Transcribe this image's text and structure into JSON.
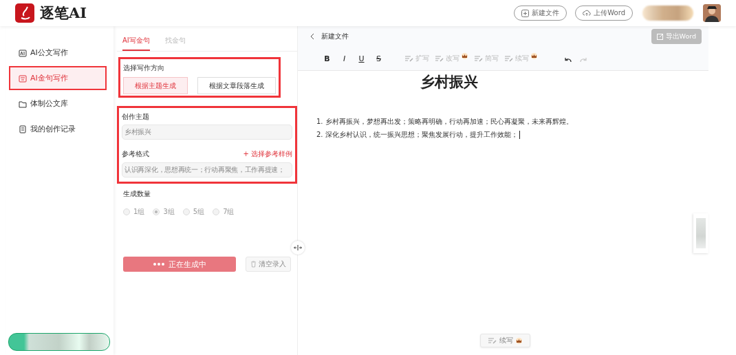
{
  "app": {
    "name": "逐笔AI"
  },
  "header": {
    "buttons": [
      {
        "label": "新建文件",
        "kind": "new"
      },
      {
        "label": "上传Word",
        "kind": "upload"
      }
    ]
  },
  "sidebar": {
    "items": [
      {
        "label": "AI公文写作",
        "kind": "ai",
        "selected": false,
        "highlighted": false
      },
      {
        "label": "AI金句写作",
        "kind": "quote",
        "selected": true,
        "highlighted": true
      },
      {
        "label": "体制公文库",
        "kind": "folder",
        "selected": false,
        "highlighted": false
      },
      {
        "label": "我的创作记录",
        "kind": "record",
        "selected": false,
        "highlighted": false
      }
    ]
  },
  "panel": {
    "tabs": [
      {
        "label": "AI写金句",
        "selected": true
      },
      {
        "label": "找金句",
        "selected": false
      }
    ],
    "direction": {
      "label": "选择写作方向",
      "highlighted": true,
      "options": [
        {
          "label": "根据主题生成",
          "selected": true
        },
        {
          "label": "根据文章段落生成",
          "selected": false
        }
      ]
    },
    "inputs": {
      "highlighted": true,
      "topic": {
        "label": "创作主题",
        "value": "乡村振兴",
        "disabled": true
      },
      "format": {
        "label": "参考格式",
        "link": "+ 选择参考样例",
        "value": "认识再深化，思想再统一；行动再聚焦，工作再提速；",
        "disabled": true
      }
    },
    "count": {
      "label": "生成数量",
      "disabled": true,
      "options": [
        {
          "label": "1组",
          "selected": false
        },
        {
          "label": "3组",
          "selected": true
        },
        {
          "label": "5组",
          "selected": false
        },
        {
          "label": "7组",
          "selected": false
        }
      ]
    },
    "generate_button": {
      "label": "正在生成中",
      "loading": true
    },
    "clear_button": {
      "label": "清空录入",
      "disabled": true
    }
  },
  "editor": {
    "back_label": "新建文件",
    "export_button": {
      "label": "导出Word",
      "disabled": true
    },
    "toolbar": [
      {
        "kind": "format",
        "label": "B"
      },
      {
        "kind": "format",
        "label": "I"
      },
      {
        "kind": "format",
        "label": "U"
      },
      {
        "kind": "format",
        "label": "S"
      },
      {
        "kind": "ai",
        "label": "扩写",
        "premium": false
      },
      {
        "kind": "ai",
        "label": "改写",
        "premium": true
      },
      {
        "kind": "ai",
        "label": "简写",
        "premium": false
      },
      {
        "kind": "ai",
        "label": "续写",
        "premium": true
      },
      {
        "kind": "undo",
        "disabled": false
      },
      {
        "kind": "redo",
        "disabled": true
      }
    ],
    "title": "乡村振兴",
    "lines": [
      "1. 乡村再振兴，梦想再出发；策略再明确，行动再加速；民心再凝聚，未来再辉煌。",
      "2. 深化乡村认识，统一振兴思想；聚焦发展行动，提升工作效能；"
    ],
    "cursor": true,
    "float_button": {
      "label": "续写",
      "premium": true
    }
  }
}
